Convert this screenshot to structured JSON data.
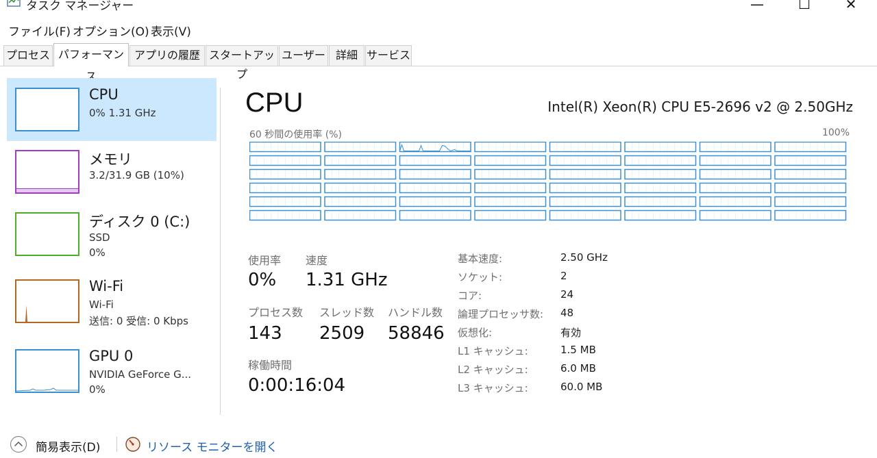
{
  "window": {
    "title": "タスク マネージャー",
    "minimize": "—",
    "maximize": "☐",
    "close": "✕"
  },
  "menu": [
    "ファイル(F)",
    "オプション(O)",
    "表示(V)"
  ],
  "tabs": [
    "プロセス",
    "パフォーマンス",
    "アプリの履歴",
    "スタートアップ",
    "ユーザー",
    "詳細",
    "サービス"
  ],
  "active_tab": "パフォーマンス",
  "sidebar": {
    "items": [
      {
        "title": "CPU",
        "lines": [
          "0%  1.31 GHz"
        ],
        "color": "#3c8fd1",
        "selected": true
      },
      {
        "title": "メモリ",
        "lines": [
          "3.2/31.9 GB (10%)"
        ],
        "color": "#a33bc6",
        "selected": false
      },
      {
        "title": "ディスク 0 (C:)",
        "lines": [
          "SSD",
          "0%"
        ],
        "color": "#4caf2a",
        "selected": false
      },
      {
        "title": "Wi-Fi",
        "lines": [
          "Wi-Fi",
          "送信: 0 受信: 0 Kbps"
        ],
        "color": "#b8661e",
        "selected": false
      },
      {
        "title": "GPU 0",
        "lines": [
          "NVIDIA GeForce G...",
          "0%"
        ],
        "color": "#3c8fd1",
        "selected": false
      }
    ]
  },
  "main": {
    "title": "CPU",
    "cpu_name": "Intel(R) Xeon(R) CPU E5-2696 v2 @ 2.50GHz",
    "graph_caption": "60 秒間の使用率 (%)",
    "graph_max": "100%",
    "graph_grid": {
      "rows": 6,
      "cols": 8,
      "color": "#3c8fd1"
    },
    "stats": {
      "usage_label": "使用率",
      "usage_value": "0%",
      "speed_label": "速度",
      "speed_value": "1.31 GHz",
      "processes_label": "プロセス数",
      "processes_value": "143",
      "threads_label": "スレッド数",
      "threads_value": "2509",
      "handles_label": "ハンドル数",
      "handles_value": "58846",
      "uptime_label": "稼働時間",
      "uptime_value": "0:00:16:04"
    },
    "specs": [
      {
        "label": "基本速度:",
        "value": "2.50 GHz"
      },
      {
        "label": "ソケット:",
        "value": "2"
      },
      {
        "label": "コア:",
        "value": "24"
      },
      {
        "label": "論理プロセッサ数:",
        "value": "48"
      },
      {
        "label": "仮想化:",
        "value": "有効"
      },
      {
        "label": "L1 キャッシュ:",
        "value": "1.5 MB"
      },
      {
        "label": "L2 キャッシュ:",
        "value": "6.0 MB"
      },
      {
        "label": "L3 キャッシュ:",
        "value": "60.0 MB"
      }
    ]
  },
  "footer": {
    "fewer_details": "簡易表示(D)",
    "resource_monitor": "リソース モニターを開く"
  },
  "colors": {
    "selected_bg": "#cce8ff",
    "link": "#1c5fb5",
    "accent": "#3c8fd1"
  }
}
